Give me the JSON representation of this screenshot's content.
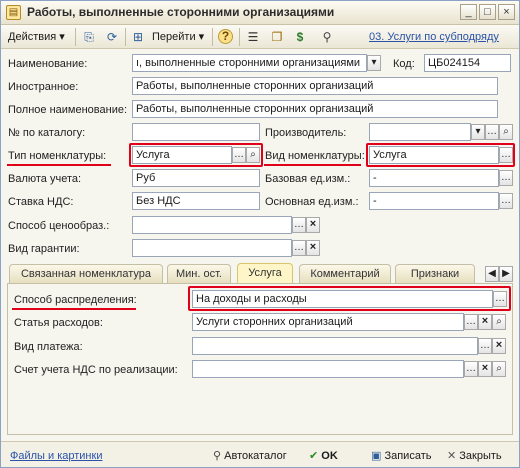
{
  "window": {
    "title": "Работы, выполненные сторонними организациями",
    "controls": {
      "minimize": "_",
      "maximize": "□",
      "close": "×"
    }
  },
  "toolbar": {
    "actions_label": "Действия",
    "goto_label": "Перейти",
    "help_glyph": "?",
    "link": "03. Услуги по субподряду"
  },
  "form": {
    "name": {
      "label": "Наименование:",
      "value": "ı, выполненные сторонними организациями"
    },
    "code": {
      "label": "Код:",
      "value": "ЦБ024154"
    },
    "foreign": {
      "label": "Иностранное:",
      "value": "Работы, выполненные сторонних организаций"
    },
    "full_name": {
      "label": "Полное наименование:",
      "value": "Работы, выполненные сторонних организаций"
    },
    "catalog_no": {
      "label": "№ по каталогу:",
      "value": ""
    },
    "manufacturer": {
      "label": "Производитель:",
      "value": ""
    },
    "nom_type": {
      "label": "Тип номенклатуры:",
      "value": "Услуга"
    },
    "nom_kind": {
      "label": "Вид номенклатуры:",
      "value": "Услуга"
    },
    "currency": {
      "label": "Валюта учета:",
      "value": "Руб"
    },
    "base_unit": {
      "label": "Базовая ед.изм.:",
      "value": "-"
    },
    "vat_rate": {
      "label": "Ставка НДС:",
      "value": "Без НДС"
    },
    "main_unit": {
      "label": "Основная ед.изм.:",
      "value": "-"
    },
    "pricing": {
      "label": "Способ ценообраз.:",
      "value": ""
    },
    "warranty": {
      "label": "Вид гарантии:",
      "value": ""
    }
  },
  "tabs": [
    {
      "label": "Связанная номенклатура"
    },
    {
      "label": "Мин. ост."
    },
    {
      "label": "Услуга"
    },
    {
      "label": "Комментарий"
    },
    {
      "label": "Признаки"
    }
  ],
  "service": {
    "distribution": {
      "label": "Способ распределения:",
      "value": "На доходы и расходы"
    },
    "expense_item": {
      "label": "Статья расходов:",
      "value": "Услуги сторонних организаций"
    },
    "payment_type": {
      "label": "Вид платежа:",
      "value": ""
    },
    "vat_account": {
      "label": "Счет учета НДС по реализации:",
      "value": ""
    }
  },
  "footer": {
    "files_link": "Файлы и картинки",
    "autocatalog": "Автокаталог",
    "ok": "OK",
    "save": "Записать",
    "close": "Закрыть"
  },
  "colors": {
    "highlight": "#e0001a",
    "link": "#2a52a8",
    "active_tab": "#fef6c8"
  }
}
